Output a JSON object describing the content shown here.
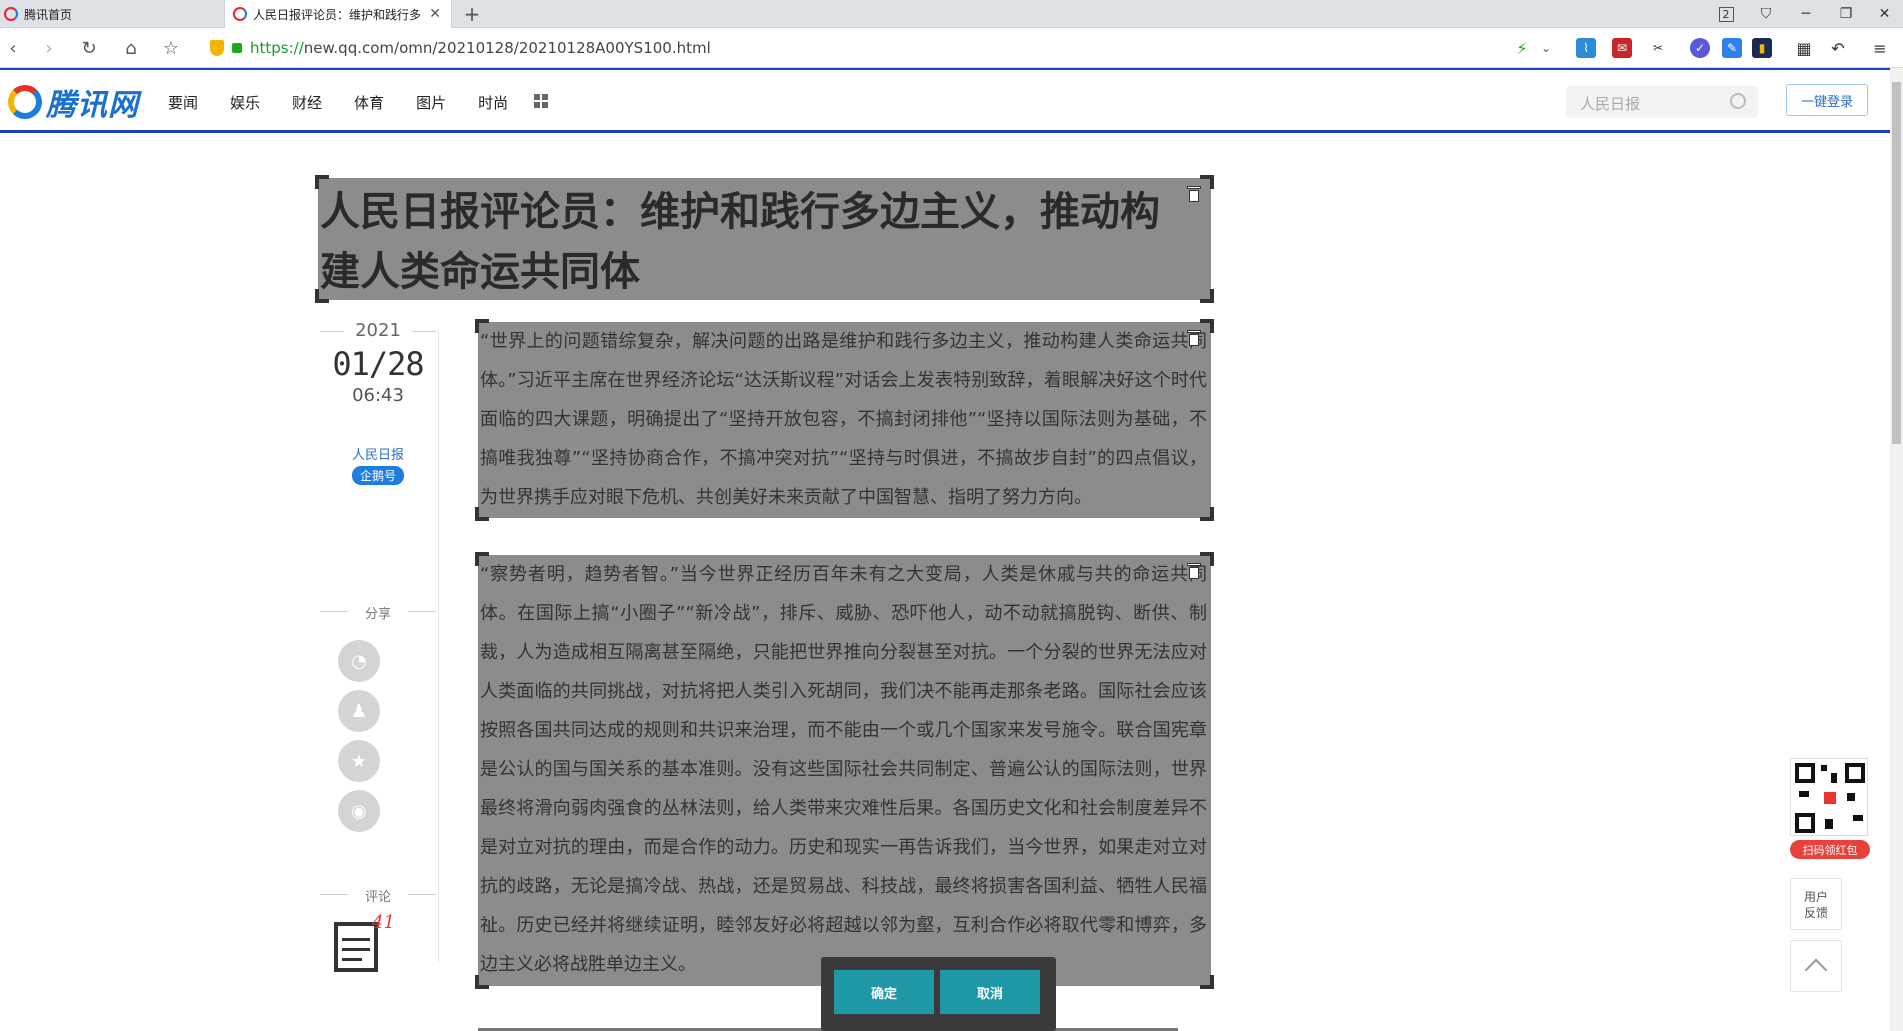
{
  "browser": {
    "tabs": [
      {
        "title": "腾讯首页"
      },
      {
        "title": "人民日报评论员：维护和践行多"
      }
    ],
    "url_scheme": "https://",
    "url_rest": "new.qq.com/omn/20210128/20210128A00YS100.html",
    "tab_count": "2"
  },
  "site": {
    "logo_text": "腾讯网",
    "nav": [
      "要闻",
      "娱乐",
      "财经",
      "体育",
      "图片",
      "时尚"
    ],
    "search_placeholder": "人民日报",
    "login_label": "一键登录"
  },
  "article": {
    "title": "人民日报评论员：维护和践行多边主义，推动构建人类命运共同体",
    "paragraphs": [
      "“世界上的问题错综复杂，解决问题的出路是维护和践行多边主义，推动构建人类命运共同体。”习近平主席在世界经济论坛“达沃斯议程”对话会上发表特别致辞，着眼解决好这个时代面临的四大课题，明确提出了“坚持开放包容，不搞封闭排他”“坚持以国际法则为基础，不搞唯我独尊”“坚持协商合作，不搞冲突对抗”“坚持与时俱进，不搞故步自封”的四点倡议，为世界携手应对眼下危机、共创美好未来贡献了中国智慧、指明了努力方向。",
      "“察势者明，趋势者智。”当今世界正经历百年未有之大变局，人类是休戚与共的命运共同体。在国际上搞“小圈子”“新冷战”，排斥、威胁、恐吓他人，动不动就搞脱钩、断供、制裁，人为造成相互隔离甚至隔绝，只能把世界推向分裂甚至对抗。一个分裂的世界无法应对人类面临的共同挑战，对抗将把人类引入死胡同，我们决不能再走那条老路。国际社会应该按照各国共同达成的规则和共识来治理，而不能由一个或几个国家来发号施令。联合国宪章是公认的国与国关系的基本准则。没有这些国际社会共同制定、普遍公认的国际法则，世界最终将滑向弱肉强食的丛林法则，给人类带来灾难性后果。各国历史文化和社会制度差异不是对立对抗的理由，而是合作的动力。历史和现实一再告诉我们，当今世界，如果走对立对抗的歧路，无论是搞冷战、热战，还是贸易战、科技战，最终将损害各国利益、牺牲人民福祉。历史已经并将继续证明，睦邻友好必将超越以邻为壑，互利合作必将取代零和博弈，多边主义必将战胜单边主义。"
    ],
    "year": "2021",
    "date": "01/28",
    "time": "06:43",
    "source": "人民日报",
    "badge": "企鹅号",
    "share_label": "分享",
    "comment_label": "评论",
    "comment_count": "41"
  },
  "widgets": {
    "redpack_label": "扫码领红包",
    "feedback_line1": "用户",
    "feedback_line2": "反馈"
  },
  "toolbar": {
    "confirm_label": "确定",
    "cancel_label": "取消"
  }
}
